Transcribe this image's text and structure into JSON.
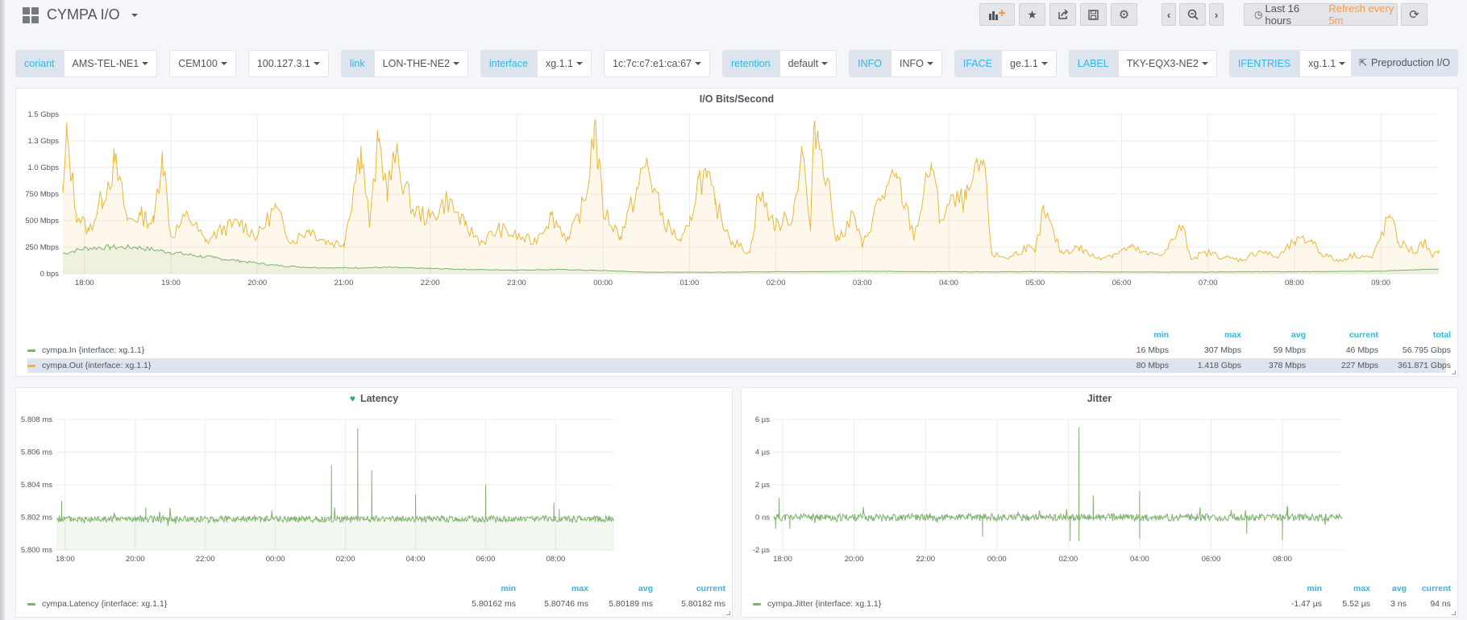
{
  "header": {
    "dashboard_title": "CYMPA I/O",
    "buttons": [
      {
        "name": "add-panel-button",
        "icon": "bar-chart-plus-icon"
      },
      {
        "name": "star-button",
        "icon": "star-icon"
      },
      {
        "name": "share-button",
        "icon": "share-icon"
      },
      {
        "name": "save-button",
        "icon": "save-icon"
      },
      {
        "name": "settings-button",
        "icon": "gear-icon"
      }
    ],
    "time_range_label": "Last 16 hours",
    "refresh_label": "Refresh every 5m",
    "nav": {
      "back_icon": "chevron-left-icon",
      "zoom_icon": "zoom-out-icon",
      "forward_icon": "chevron-right-icon",
      "refresh_icon": "refresh-icon"
    }
  },
  "variables": [
    {
      "label": "coriant",
      "value": "AMS-TEL-NE1"
    },
    {
      "label": "",
      "value": "CEM100"
    },
    {
      "label": "",
      "value": "100.127.3.1"
    },
    {
      "label": "link",
      "value": "LON-THE-NE2"
    },
    {
      "label": "interface",
      "value": "xg.1.1"
    },
    {
      "label": "",
      "value": "1c:7c:c7:e1:ca:67"
    },
    {
      "label": "retention",
      "value": "default"
    },
    {
      "label": "INFO",
      "value": "INFO"
    },
    {
      "label": "IFACE",
      "value": "ge.1.1"
    },
    {
      "label": "LABEL",
      "value": "TKY-EQX3-NE2"
    },
    {
      "label": "IFENTRIES",
      "value": "xg.1.1"
    }
  ],
  "dashboard_link": {
    "label": "Preproduction I/O",
    "icon": "external-link-icon"
  },
  "colors": {
    "in": "#7eb26d",
    "out": "#eab839",
    "accent": "#33b5e5",
    "refresh": "#f79a4d"
  },
  "chart_data": [
    {
      "type": "area",
      "title": "I/O Bits/Second",
      "x_ticks": [
        "18:00",
        "19:00",
        "20:00",
        "21:00",
        "22:00",
        "23:00",
        "00:00",
        "01:00",
        "02:00",
        "03:00",
        "04:00",
        "05:00",
        "06:00",
        "07:00",
        "08:00",
        "09:00"
      ],
      "x_range_hours": [
        17.75,
        33.67
      ],
      "y_ticks": [
        "0 bps",
        "250 Mbps",
        "500 Mbps",
        "750 Mbps",
        "1.0 Gbps",
        "1.3 Gbps",
        "1.5 Gbps"
      ],
      "y_range_mbps": [
        0,
        1500
      ],
      "grid": true,
      "series": [
        {
          "name": "cympa.In {interface: xg.1.1}",
          "color": "#7eb26d",
          "approx_points_mbps": [
            [
              17.75,
              190
            ],
            [
              18.0,
              240
            ],
            [
              18.3,
              250
            ],
            [
              18.6,
              250
            ],
            [
              18.9,
              215
            ],
            [
              19.2,
              180
            ],
            [
              19.5,
              150
            ],
            [
              19.8,
              120
            ],
            [
              20.2,
              80
            ],
            [
              20.6,
              60
            ],
            [
              21.0,
              55
            ],
            [
              21.5,
              60
            ],
            [
              22.0,
              50
            ],
            [
              22.5,
              40
            ],
            [
              23.0,
              35
            ],
            [
              23.5,
              40
            ],
            [
              24.0,
              30
            ],
            [
              24.5,
              15
            ],
            [
              25.0,
              15
            ],
            [
              25.5,
              15
            ],
            [
              26.0,
              20
            ],
            [
              26.5,
              20
            ],
            [
              27.0,
              25
            ],
            [
              27.5,
              20
            ],
            [
              28.0,
              20
            ],
            [
              28.5,
              18
            ],
            [
              29.0,
              20
            ],
            [
              29.5,
              18
            ],
            [
              30.0,
              18
            ],
            [
              30.5,
              16
            ],
            [
              31.0,
              16
            ],
            [
              31.5,
              20
            ],
            [
              32.0,
              20
            ],
            [
              32.5,
              22
            ],
            [
              33.0,
              25
            ],
            [
              33.67,
              46
            ]
          ],
          "stats": {
            "min": "16 Mbps",
            "max": "307 Mbps",
            "avg": "59 Mbps",
            "current": "46 Mbps",
            "total": "56.795 Gbps"
          }
        },
        {
          "name": "cympa.Out {interface: xg.1.1}",
          "color": "#eab839",
          "approx_points_mbps": [
            [
              17.75,
              760
            ],
            [
              17.8,
              1300
            ],
            [
              17.9,
              580
            ],
            [
              18.05,
              400
            ],
            [
              18.2,
              700
            ],
            [
              18.35,
              1050
            ],
            [
              18.5,
              500
            ],
            [
              18.65,
              550
            ],
            [
              18.8,
              480
            ],
            [
              18.9,
              1150
            ],
            [
              19.0,
              350
            ],
            [
              19.2,
              550
            ],
            [
              19.4,
              300
            ],
            [
              19.6,
              420
            ],
            [
              19.8,
              480
            ],
            [
              20.0,
              350
            ],
            [
              20.2,
              620
            ],
            [
              20.4,
              300
            ],
            [
              20.6,
              420
            ],
            [
              20.8,
              300
            ],
            [
              21.0,
              280
            ],
            [
              21.2,
              1200
            ],
            [
              21.3,
              450
            ],
            [
              21.4,
              1250
            ],
            [
              21.5,
              800
            ],
            [
              21.6,
              1100
            ],
            [
              21.8,
              600
            ],
            [
              22.0,
              520
            ],
            [
              22.2,
              700
            ],
            [
              22.4,
              450
            ],
            [
              22.6,
              300
            ],
            [
              22.8,
              420
            ],
            [
              23.0,
              350
            ],
            [
              23.2,
              300
            ],
            [
              23.4,
              550
            ],
            [
              23.6,
              320
            ],
            [
              23.8,
              700
            ],
            [
              23.9,
              1420
            ],
            [
              24.0,
              600
            ],
            [
              24.2,
              350
            ],
            [
              24.4,
              800
            ],
            [
              24.5,
              1050
            ],
            [
              24.7,
              500
            ],
            [
              24.9,
              300
            ],
            [
              25.0,
              450
            ],
            [
              25.1,
              900
            ],
            [
              25.2,
              900
            ],
            [
              25.3,
              650
            ],
            [
              25.5,
              300
            ],
            [
              25.7,
              200
            ],
            [
              25.8,
              760
            ],
            [
              26.0,
              450
            ],
            [
              26.2,
              550
            ],
            [
              26.3,
              1200
            ],
            [
              26.4,
              400
            ],
            [
              26.45,
              1440
            ],
            [
              26.6,
              900
            ],
            [
              26.7,
              300
            ],
            [
              26.9,
              560
            ],
            [
              27.0,
              250
            ],
            [
              27.2,
              700
            ],
            [
              27.4,
              900
            ],
            [
              27.6,
              350
            ],
            [
              27.8,
              1050
            ],
            [
              27.9,
              500
            ],
            [
              28.0,
              650
            ],
            [
              28.2,
              700
            ],
            [
              28.4,
              1070
            ],
            [
              28.5,
              180
            ],
            [
              28.7,
              150
            ],
            [
              28.9,
              250
            ],
            [
              29.0,
              200
            ],
            [
              29.1,
              600
            ],
            [
              29.3,
              200
            ],
            [
              29.5,
              250
            ],
            [
              29.7,
              150
            ],
            [
              29.9,
              180
            ],
            [
              30.1,
              250
            ],
            [
              30.3,
              180
            ],
            [
              30.5,
              200
            ],
            [
              30.7,
              450
            ],
            [
              30.8,
              150
            ],
            [
              31.0,
              200
            ],
            [
              31.2,
              150
            ],
            [
              31.4,
              130
            ],
            [
              31.6,
              220
            ],
            [
              31.8,
              150
            ],
            [
              32.0,
              300
            ],
            [
              32.2,
              320
            ],
            [
              32.3,
              200
            ],
            [
              32.5,
              120
            ],
            [
              32.7,
              180
            ],
            [
              32.9,
              150
            ],
            [
              33.1,
              550
            ],
            [
              33.2,
              300
            ],
            [
              33.4,
              200
            ],
            [
              33.5,
              300
            ],
            [
              33.6,
              150
            ],
            [
              33.67,
              227
            ]
          ],
          "stats": {
            "min": "80 Mbps",
            "max": "1.418 Gbps",
            "avg": "378 Mbps",
            "current": "227 Mbps",
            "total": "361.871 Gbps"
          }
        }
      ],
      "legend": {
        "placement": "bottom",
        "columns": [
          "min",
          "max",
          "avg",
          "current",
          "total"
        ]
      }
    },
    {
      "type": "area",
      "title": "Latency",
      "title_icon": "heart-icon",
      "x_ticks": [
        "18:00",
        "20:00",
        "22:00",
        "00:00",
        "02:00",
        "04:00",
        "06:00",
        "08:00"
      ],
      "x_range_hours": [
        17.75,
        33.67
      ],
      "y_ticks": [
        "5.800 ms",
        "5.802 ms",
        "5.804 ms",
        "5.806 ms",
        "5.808 ms"
      ],
      "y_range": [
        5.8,
        5.808
      ],
      "grid": true,
      "series": [
        {
          "name": "cympa.Latency {interface: xg.1.1}",
          "color": "#7eb26d",
          "baseline": 5.8019,
          "spikes": [
            [
              17.9,
              5.803
            ],
            [
              20.3,
              5.8026
            ],
            [
              25.6,
              5.8052
            ],
            [
              26.35,
              5.80746
            ],
            [
              26.75,
              5.8049
            ],
            [
              28.0,
              5.8034
            ],
            [
              30.0,
              5.804
            ],
            [
              31.95,
              5.8029
            ],
            [
              32.1,
              5.8025
            ]
          ],
          "stats": {
            "min": "5.80162 ms",
            "max": "5.80746 ms",
            "avg": "5.80189 ms",
            "current": "5.80182 ms"
          }
        }
      ],
      "legend": {
        "placement": "bottom",
        "columns": [
          "min",
          "max",
          "avg",
          "current"
        ]
      }
    },
    {
      "type": "line",
      "title": "Jitter",
      "x_ticks": [
        "18:00",
        "20:00",
        "22:00",
        "00:00",
        "02:00",
        "04:00",
        "06:00",
        "08:00"
      ],
      "x_range_hours": [
        17.75,
        33.67
      ],
      "y_ticks": [
        "-2 µs",
        "0 ns",
        "2 µs",
        "4 µs",
        "6 µs"
      ],
      "y_range_us": [
        -2,
        6
      ],
      "grid": true,
      "series": [
        {
          "name": "cympa.Jitter {interface: xg.1.1}",
          "color": "#7eb26d",
          "baseline": 0,
          "spikes": [
            [
              17.9,
              1.2
            ],
            [
              17.8,
              -0.7
            ],
            [
              18.2,
              -0.7
            ],
            [
              23.6,
              -1.2
            ],
            [
              26.05,
              -1.45
            ],
            [
              26.3,
              5.52
            ],
            [
              26.3,
              -1.47
            ],
            [
              26.7,
              1.35
            ],
            [
              28.0,
              1.6
            ],
            [
              28.0,
              -1.3
            ],
            [
              32.0,
              -1.4
            ],
            [
              32.15,
              0.6
            ],
            [
              31.0,
              -1.0
            ]
          ],
          "stats": {
            "min": "-1.47 µs",
            "max": "5.52 µs",
            "avg": "3 ns",
            "current": "94 ns"
          }
        }
      ],
      "legend": {
        "placement": "bottom",
        "columns": [
          "min",
          "max",
          "avg",
          "current"
        ]
      }
    }
  ]
}
